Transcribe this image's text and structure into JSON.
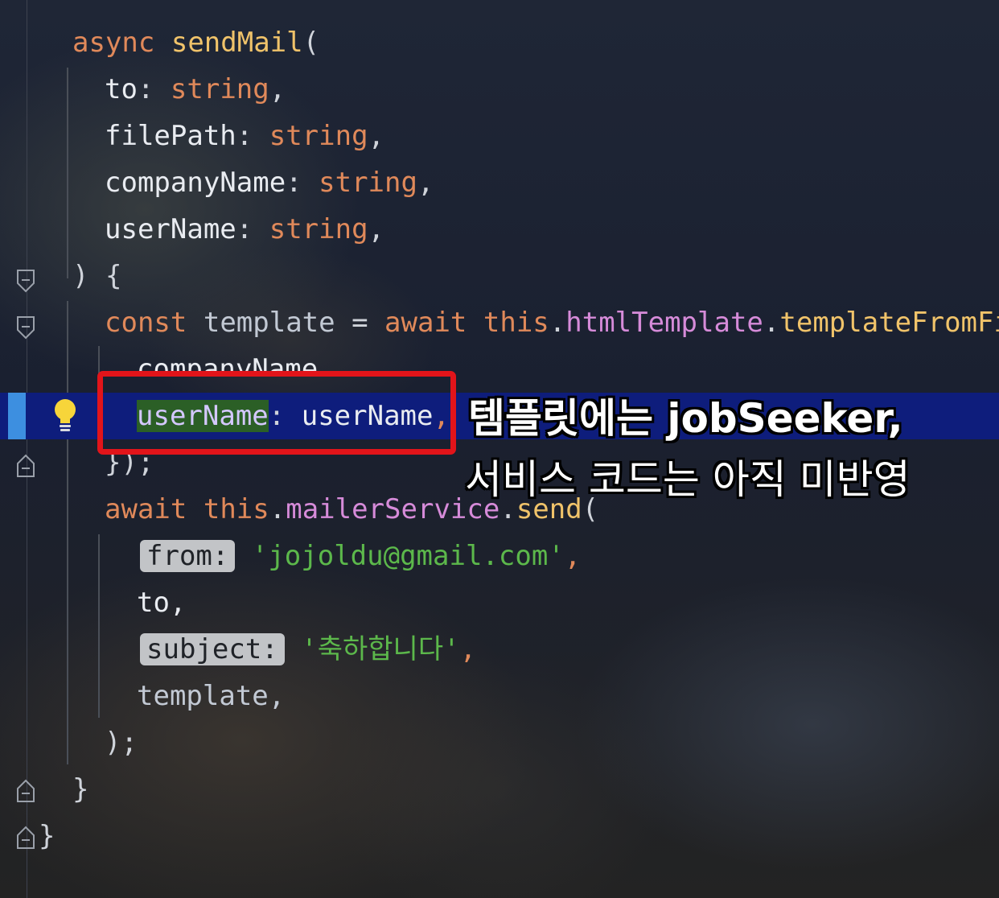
{
  "editor": {
    "lines": {
      "l1_async": "async",
      "l1_fn": "sendMail",
      "l1_paren": "(",
      "l2_prop": "to",
      "l2_type": "string",
      "l3_prop": "filePath",
      "l3_type": "string",
      "l4_prop": "companyName",
      "l4_type": "string",
      "l5_prop": "userName",
      "l5_type": "string",
      "l6": ") {",
      "l7_const": "const",
      "l7_var": "template",
      "l7_eq": " = ",
      "l7_await": "await",
      "l7_this": "this",
      "l7_member1": "htmlTemplate",
      "l7_member2": "templateFromFi",
      "l8": "companyName,",
      "l9_key": "userName",
      "l9_val": "userName",
      "l10": "});",
      "l11_await": "await",
      "l11_this": "this",
      "l11_member": "mailerService",
      "l11_send": "send",
      "l12_hint": "from:",
      "l12_str": "'jojoldu@gmail.com'",
      "l13": "to,",
      "l14_hint": "subject:",
      "l14_str": "'축하합니다'",
      "l15": "template,",
      "l16": ");",
      "l17": "}",
      "l18": "}"
    }
  },
  "overlay": {
    "caption_line1": "템플릿에는 jobSeeker,",
    "caption_line2": "서비스 코드는 아직 미반영"
  },
  "icons": [
    "fold-collapse-icon",
    "lightbulb-icon"
  ],
  "colors": {
    "highlight_line": "#0e1d7c",
    "annotation_border": "#e2141a",
    "keyword": "#e0895a",
    "function": "#f0c36a",
    "string": "#5cb84b"
  }
}
